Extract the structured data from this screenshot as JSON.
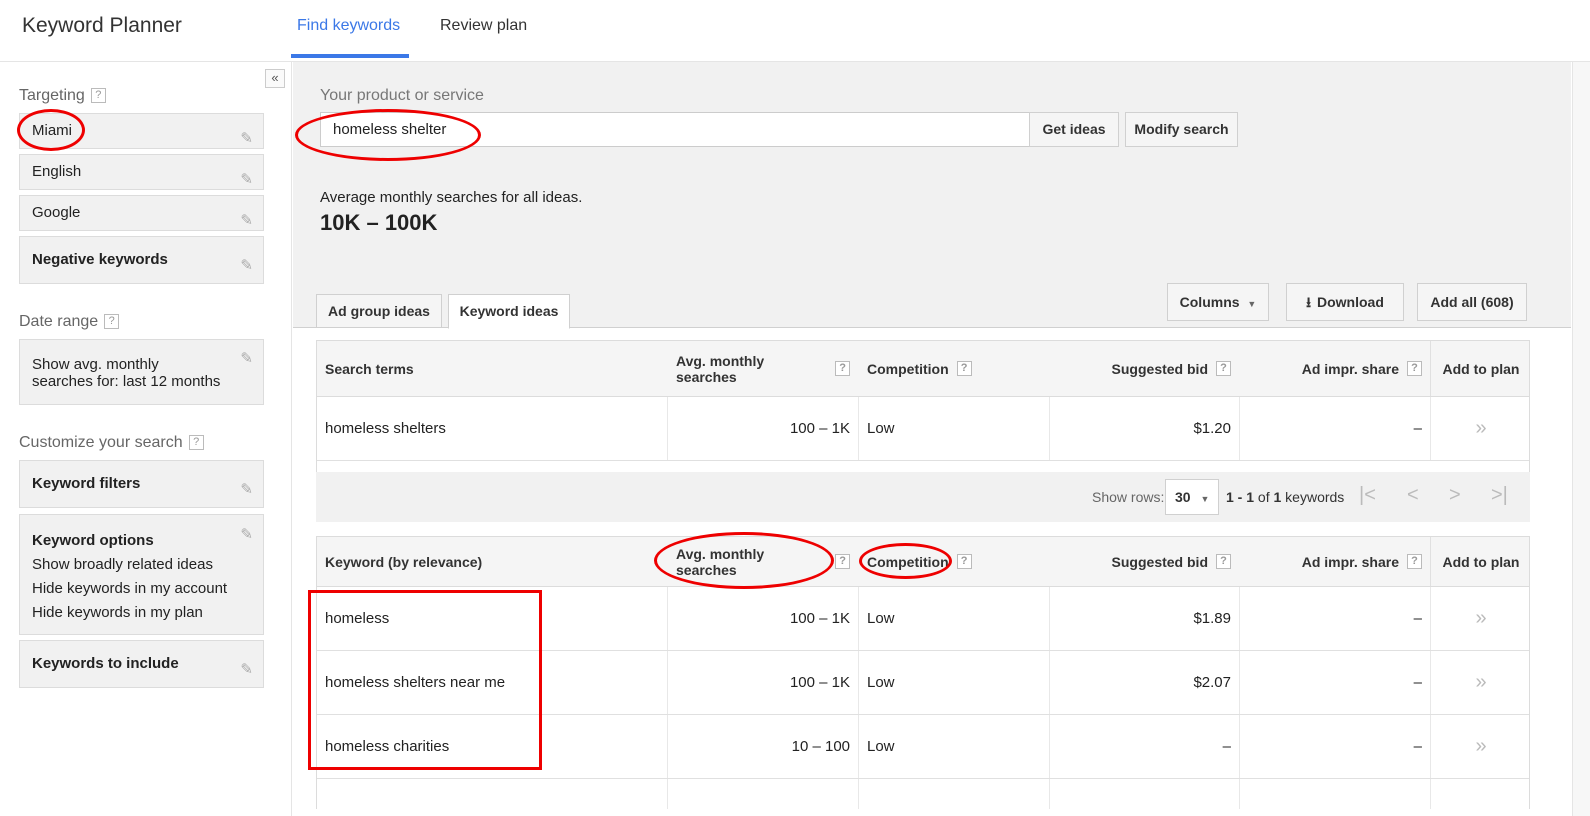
{
  "header": {
    "app_title": "Keyword Planner",
    "tabs": [
      "Find keywords",
      "Review plan"
    ]
  },
  "sidebar": {
    "collapse_icon": "«",
    "targeting_label": "Targeting",
    "targeting_items": [
      "Miami",
      "English",
      "Google",
      "Negative keywords"
    ],
    "date_range_label": "Date range",
    "date_range_value": "Show avg. monthly searches for: last 12 months",
    "customize_label": "Customize your search",
    "keyword_filters": "Keyword filters",
    "keyword_options": {
      "title": "Keyword options",
      "lines": [
        "Show broadly related ideas",
        "Hide keywords in my account",
        "Hide keywords in my plan"
      ]
    },
    "keywords_to_include": "Keywords to include",
    "help_glyph": "?"
  },
  "main": {
    "product_label": "Your product or service",
    "product_value": "homeless shelter",
    "get_ideas": "Get ideas",
    "modify_search": "Modify search",
    "avg_label": "Average monthly searches for all ideas.",
    "avg_value": "10K – 100K",
    "tabs": [
      "Ad group ideas",
      "Keyword ideas"
    ],
    "columns_button": "Columns",
    "download_button": "Download",
    "add_all_button": "Add all (608)",
    "search_terms_table": {
      "headers": [
        "Search terms",
        "Avg. monthly searches",
        "Competition",
        "Suggested bid",
        "Ad impr. share",
        "Add to plan"
      ],
      "rows": [
        [
          "homeless shelters",
          "100 – 1K",
          "Low",
          "$1.20",
          "–"
        ]
      ]
    },
    "pager": {
      "show_rows_label": "Show rows:",
      "rows_value": "30",
      "range_start": "1 - 1",
      "range_of": "of",
      "range_total": "1",
      "range_suffix": "keywords"
    },
    "keyword_table": {
      "headers": [
        "Keyword (by relevance)",
        "Avg. monthly searches",
        "Competition",
        "Suggested bid",
        "Ad impr. share",
        "Add to plan"
      ],
      "rows": [
        [
          "homeless",
          "100 – 1K",
          "Low",
          "$1.89",
          "–"
        ],
        [
          "homeless shelters near me",
          "100 – 1K",
          "Low",
          "$2.07",
          "–"
        ],
        [
          "homeless charities",
          "10 – 100",
          "Low",
          "–",
          "–"
        ]
      ]
    },
    "add_glyph": "»"
  },
  "annotation_color": "#e00000",
  "accent_color": "#3b78e7"
}
